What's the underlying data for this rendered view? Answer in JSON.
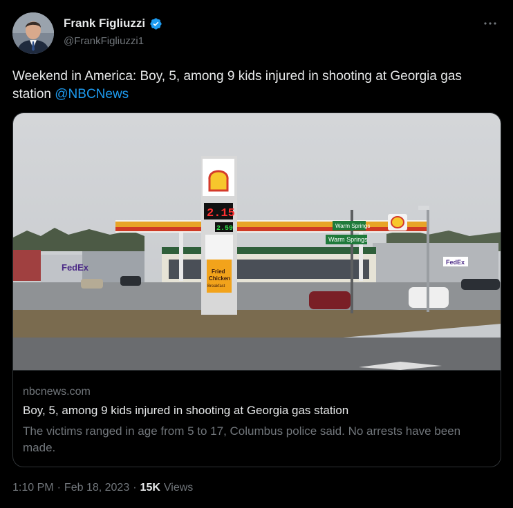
{
  "author": {
    "name": "Frank Figliuzzi",
    "handle": "@FrankFigliuzzi1",
    "verified": true
  },
  "tweet": {
    "text_main": "Weekend in America: Boy, 5, among 9 kids injured in shooting at Georgia gas station",
    "mention": "@NBCNews"
  },
  "card": {
    "domain": "nbcnews.com",
    "headline": "Boy, 5, among 9 kids injured in shooting at Georgia gas station",
    "description": "The victims ranged in age from 5 to 17, Columbus police said. No arrests have been made.",
    "image": {
      "sign_price_top": "2.15",
      "sign_price_bottom": "2.59",
      "sign_food_line1": "Fried",
      "sign_food_line2": "Chicken",
      "sign_food_line3": "Breakfast",
      "street_sign_1": "Warm Springs",
      "street_sign_2": "Warm Springs",
      "store_logo_left": "FedEx",
      "store_logo_right": "FedEx"
    }
  },
  "meta": {
    "time": "1:10 PM",
    "separator": "·",
    "date": "Feb 18, 2023",
    "views_count": "15K",
    "views_label": "Views"
  },
  "colors": {
    "background": "#000000",
    "text": "#e7e9ea",
    "muted": "#71767b",
    "accent": "#1d9bf0",
    "border": "#2f3336"
  }
}
